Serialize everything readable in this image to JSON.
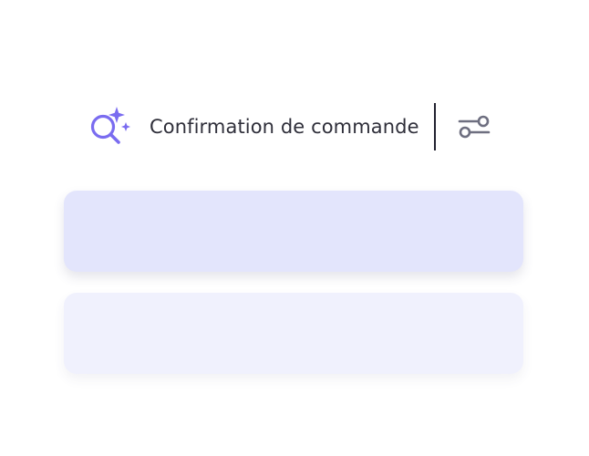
{
  "search": {
    "query": "Confirmation de commande",
    "icon": "ai-search-sparkle-icon",
    "filter_icon": "filter-sliders-icon"
  },
  "results": [
    {
      "label": ""
    },
    {
      "label": ""
    }
  ],
  "colors": {
    "accent": "#7a6cf0",
    "text": "#2f2f3a",
    "icon_gray": "#6e6f80",
    "card_primary": "#e3e5fc",
    "card_secondary": "#f0f1fd"
  }
}
